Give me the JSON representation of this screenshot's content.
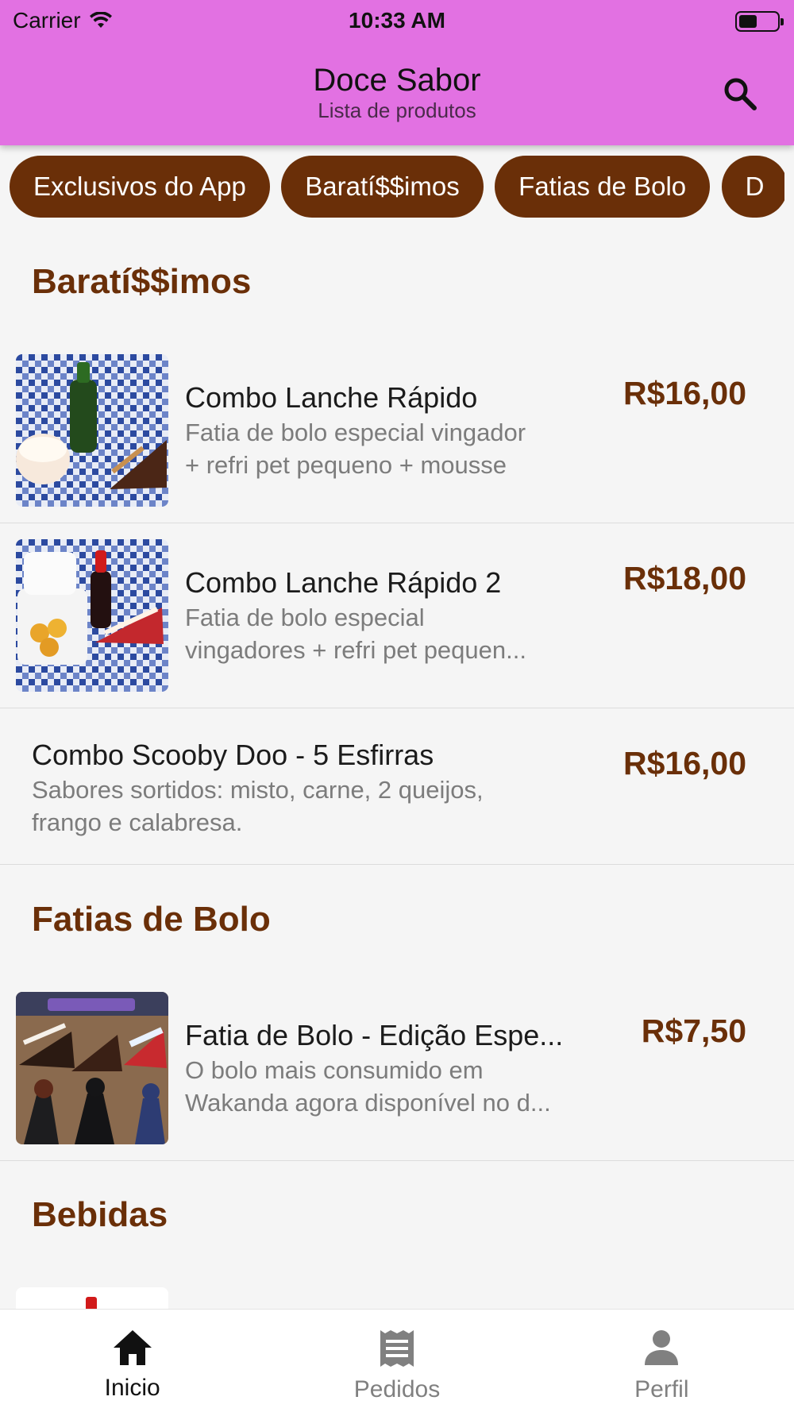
{
  "status_bar": {
    "carrier": "Carrier",
    "time": "10:33 AM"
  },
  "header": {
    "title": "Doce Sabor",
    "subtitle": "Lista de produtos"
  },
  "chips": [
    "Exclusivos do App",
    "Baratí$$imos",
    "Fatias de Bolo",
    "D"
  ],
  "sections": {
    "baratissimos": {
      "title": "Baratí$$imos",
      "items": [
        {
          "name": "Combo Lanche Rápido",
          "desc1": "Fatia de bolo especial vingador",
          "desc2": "+ refri pet pequeno + mousse",
          "price": "R$16,00"
        },
        {
          "name": "Combo Lanche Rápido 2",
          "desc1": "Fatia de bolo especial",
          "desc2": "vingadores + refri pet pequen...",
          "price": "R$18,00"
        },
        {
          "name": "Combo Scooby Doo - 5 Esfirras",
          "desc1": "Sabores sortidos: misto, carne, 2 queijos,",
          "desc2": "frango e calabresa.",
          "price": "R$16,00"
        }
      ]
    },
    "fatias": {
      "title": "Fatias de Bolo",
      "items": [
        {
          "name": "Fatia de Bolo - Edição Espe...",
          "desc1": "O bolo mais consumido em",
          "desc2": "Wakanda agora disponível no d...",
          "price": "R$7,50"
        }
      ]
    },
    "bebidas": {
      "title": "Bebidas"
    }
  },
  "bottom_nav": [
    {
      "label": "Inicio",
      "icon": "home-icon",
      "active": true
    },
    {
      "label": "Pedidos",
      "icon": "receipt-icon",
      "active": false
    },
    {
      "label": "Perfil",
      "icon": "person-icon",
      "active": false
    }
  ],
  "colors": {
    "appbar": "#e271e2",
    "brand": "#6a2f08",
    "background": "#f5f5f5"
  }
}
